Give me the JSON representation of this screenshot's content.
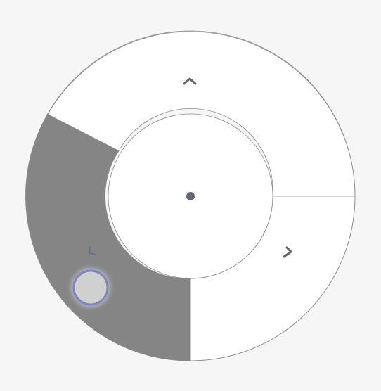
{
  "dial": {
    "sectors": [
      {
        "id": "top",
        "icon": "chevron-up-icon",
        "state": "idle"
      },
      {
        "id": "right",
        "icon": "chevron-right-icon",
        "state": "idle"
      },
      {
        "id": "bottom-left",
        "icon": "chevron-left-icon",
        "state": "active"
      }
    ],
    "colors": {
      "background": "#f6f6f6",
      "sector_fill": "#ffffff",
      "active_fill": "#858585",
      "outline": "#8a8a8a",
      "icon": "#5f6571",
      "handle_fill": "#d0d0d0",
      "handle_ring": "#7f86b8"
    }
  }
}
